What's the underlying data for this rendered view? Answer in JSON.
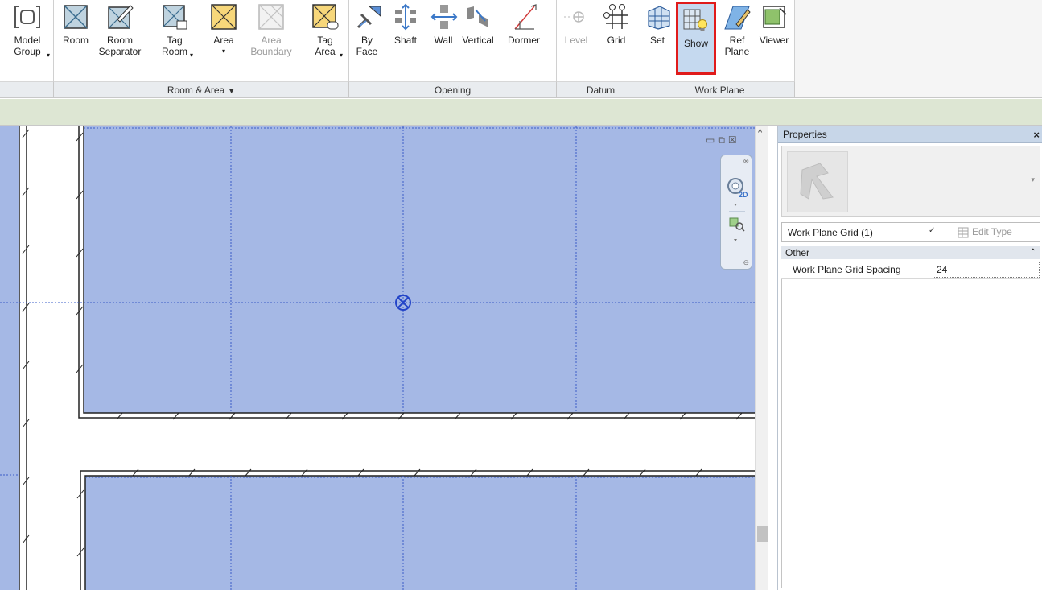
{
  "ribbon": {
    "model_group": {
      "label": "Model\nGroup"
    },
    "room": {
      "label": "Room"
    },
    "room_separator": {
      "label": "Room\nSeparator"
    },
    "tag_room": {
      "label": "Tag\nRoom"
    },
    "area": {
      "label": "Area"
    },
    "area_boundary": {
      "label": "Area\nBoundary"
    },
    "tag_area": {
      "label": "Tag\nArea"
    },
    "by_face": {
      "label": "By\nFace"
    },
    "shaft": {
      "label": "Shaft"
    },
    "wall": {
      "label": "Wall"
    },
    "vertical": {
      "label": "Vertical"
    },
    "dormer": {
      "label": "Dormer"
    },
    "level": {
      "label": "Level"
    },
    "grid": {
      "label": "Grid"
    },
    "set": {
      "label": "Set"
    },
    "show": {
      "label": "Show"
    },
    "ref_plane": {
      "label": "Ref\nPlane"
    },
    "viewer": {
      "label": "Viewer"
    },
    "panels": {
      "room_area": "Room & Area",
      "opening": "Opening",
      "datum": "Datum",
      "work_plane": "Work Plane"
    }
  },
  "view": {
    "fill_color": "#a5b8e5",
    "grid_line_color": "#3a5cc8",
    "origin_marker_icon": "circled-x-icon"
  },
  "properties": {
    "title": "Properties",
    "close_glyph": "×",
    "type_name": "Work Plane Grid (1)",
    "edit_type": "Edit Type",
    "category": "Other",
    "params": [
      {
        "name": "Work Plane Grid Spacing",
        "value": "24"
      }
    ]
  }
}
